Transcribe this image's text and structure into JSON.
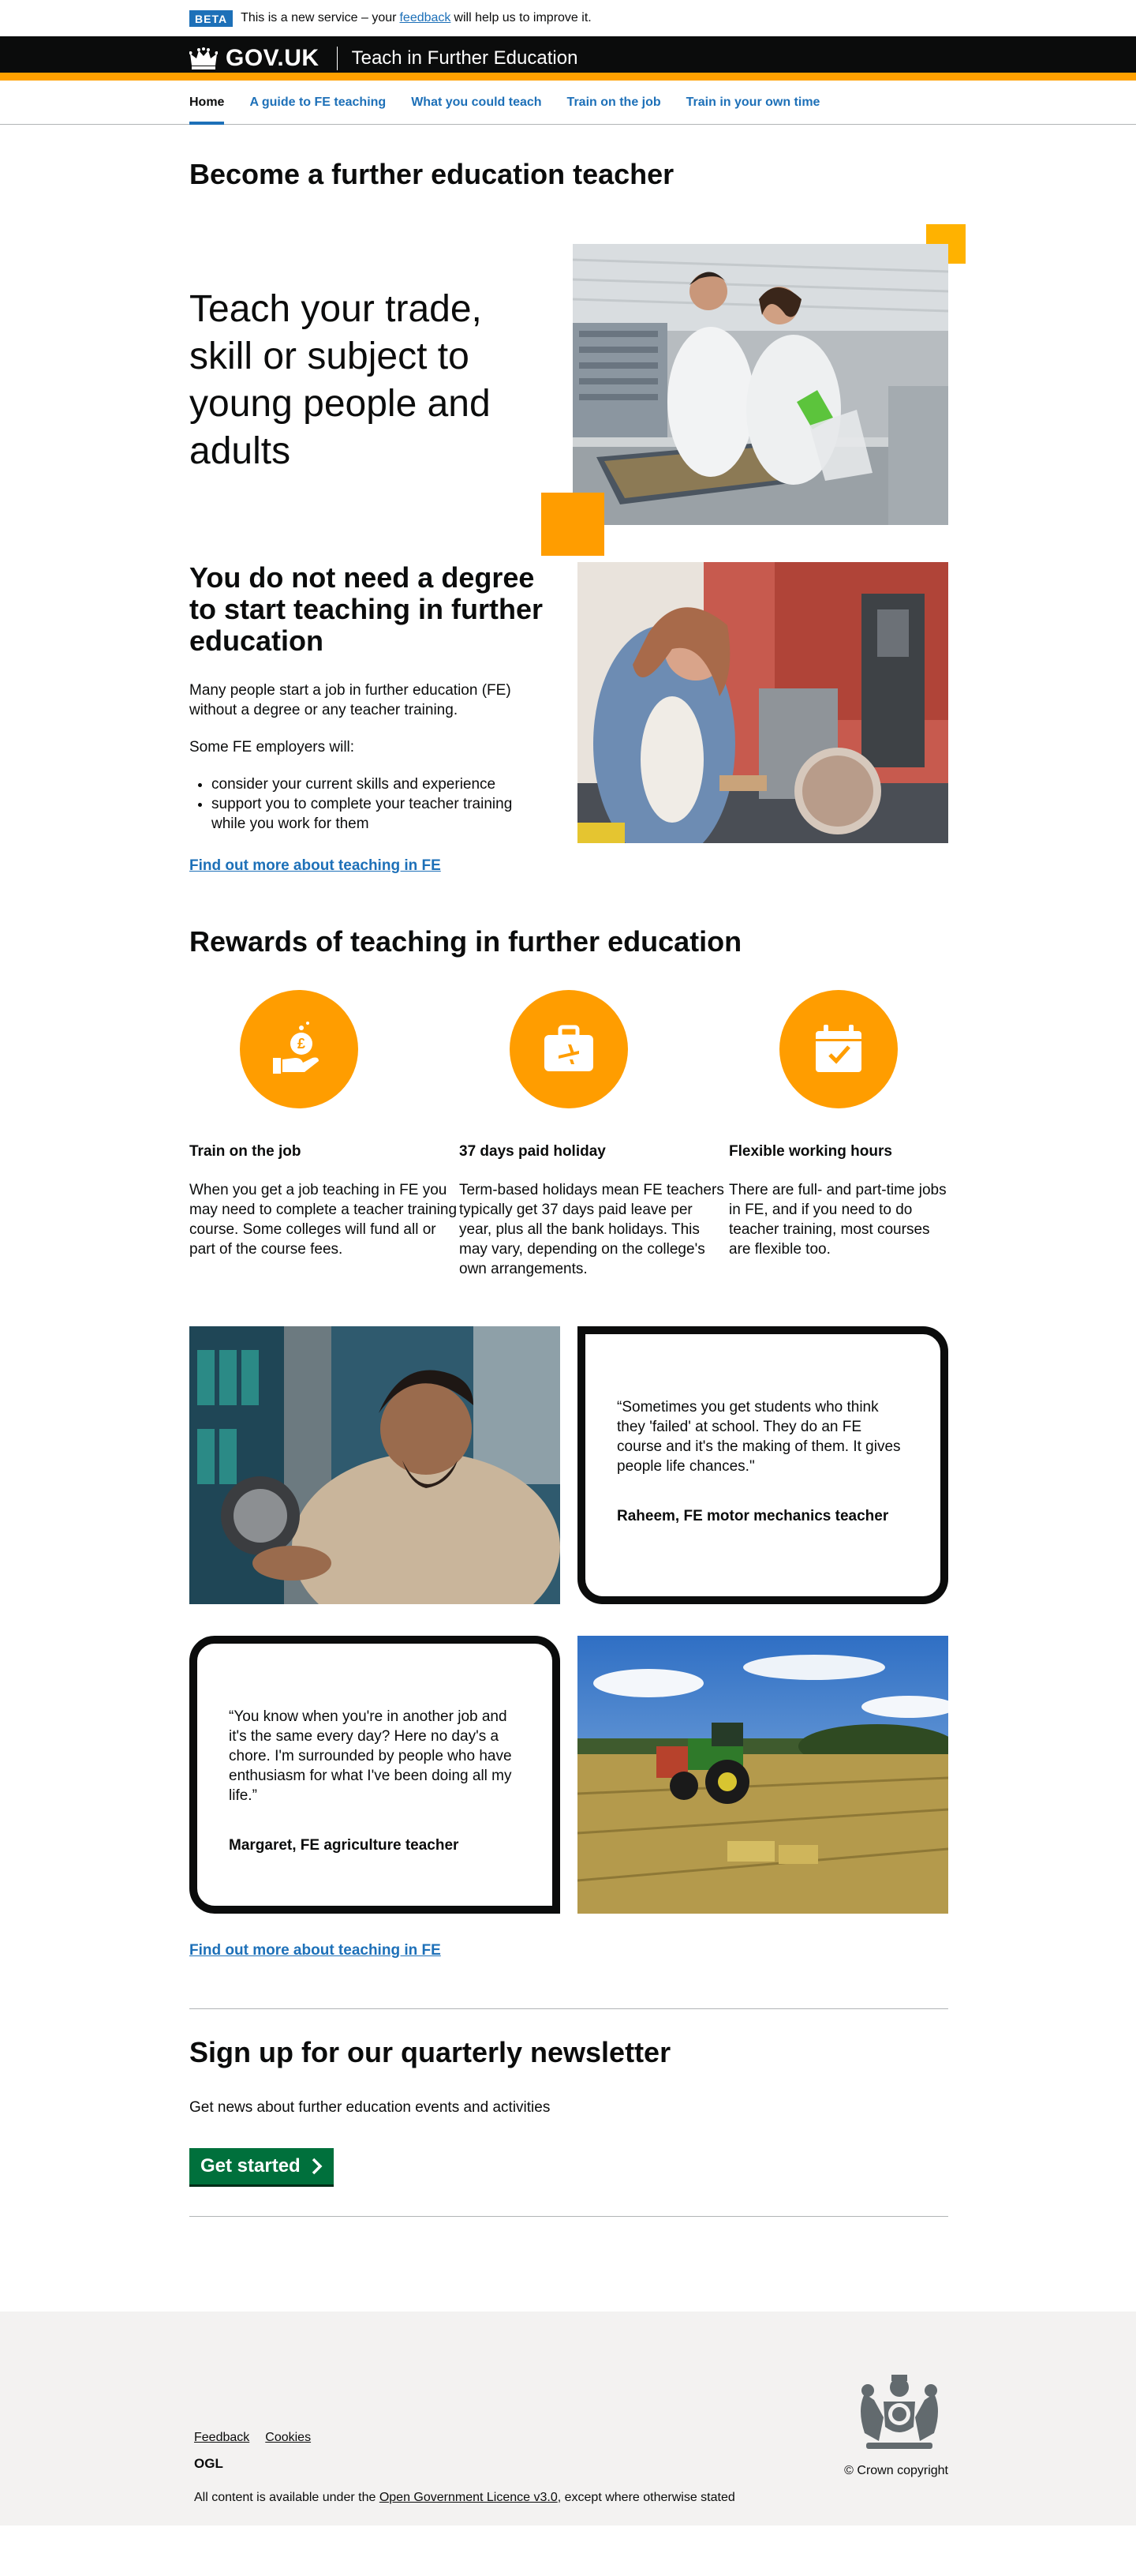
{
  "phase": {
    "tag": "BETA",
    "text_before": "This is a new service – your",
    "link": "feedback",
    "text_after": "will help us to improve it."
  },
  "header": {
    "logo": "GOV.UK",
    "service": "Teach in Further Education"
  },
  "nav": {
    "items": [
      "Home",
      "A guide to FE teaching",
      "What you could teach",
      "Train on the job",
      "Train in your own time"
    ],
    "active": "Home"
  },
  "page_title": "Become  a further education teacher",
  "hero": {
    "text": "Teach your trade, skill or subject to young people and adults"
  },
  "degree": {
    "heading": "You do not need a degree to start teaching in further education",
    "p1": "Many people start a job in further education (FE) without a degree or any teacher training.",
    "p2": "Some FE employers will:",
    "bullets": [
      "consider your current skills and experience",
      "support you to complete your teacher training while you work for them"
    ],
    "link": "Find out more about teaching in FE"
  },
  "rewards": {
    "heading": "Rewards of teaching in further education",
    "items": [
      {
        "icon": "money-hand-icon",
        "title": "Train on the job",
        "text": "When you get a job teaching in FE you may need to complete a teacher training course. Some colleges will fund all or part of the course fees."
      },
      {
        "icon": "suitcase-plane-icon",
        "title": "37 days paid holiday",
        "text": "Term-based holidays mean FE teachers typically get 37 days paid leave per year, plus all the bank holidays. This may vary, depending on the college's own arrangements."
      },
      {
        "icon": "calendar-check-icon",
        "title": "Flexible working hours",
        "text": "There are full- and part-time jobs in FE, and if you need to do teacher training, most courses are flexible too."
      }
    ]
  },
  "quotes": [
    {
      "text": "“Sometimes you get students who think they 'failed' at school. They do an FE course and it's the making of them. It gives people life chances.\"",
      "who": "Raheem, FE motor mechanics teacher"
    },
    {
      "text": "“You know when you're in another job and it's the same every day? Here no day's a chore. I'm surrounded by people who have enthusiasm for what I've been doing all my life.”",
      "who": "Margaret, FE agriculture teacher"
    }
  ],
  "find_more": "Find out more about teaching in FE",
  "newsletter": {
    "heading": "Sign up for our  quarterly newsletter",
    "text": "Get news about further education events and activities",
    "button": "Get started"
  },
  "footer": {
    "links": [
      "Feedback",
      "Cookies"
    ],
    "ogl": "OGL",
    "licence_before": "All content is available under the",
    "licence_link": "Open Government Licence v3.0",
    "licence_after": ", except where otherwise stated",
    "copyright": "© Crown copyright"
  },
  "colors": {
    "brand_orange": "#ff9d00",
    "link_blue": "#1d70b8",
    "button_green": "#00703c",
    "header_black": "#0b0c0c"
  }
}
